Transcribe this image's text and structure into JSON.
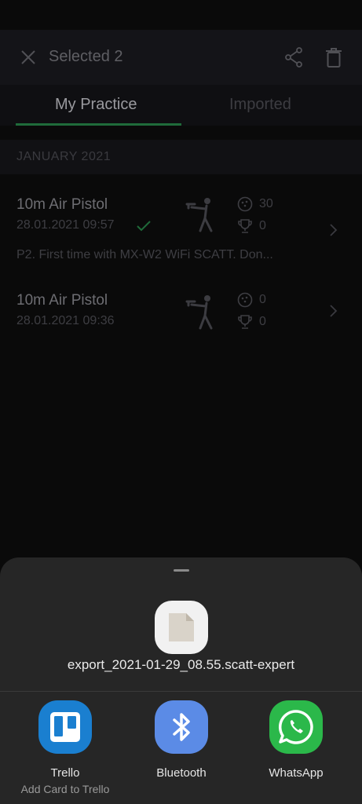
{
  "appbar": {
    "title": "Selected 2",
    "close_icon": "close-icon",
    "share_icon": "share-icon",
    "delete_icon": "trash-icon"
  },
  "tabs": [
    {
      "label": "My Practice",
      "active": true
    },
    {
      "label": "Imported",
      "active": false
    }
  ],
  "section": {
    "header": "JANUARY 2021"
  },
  "sessions": [
    {
      "name": "10m Air Pistol",
      "datetime": "28.01.2021 09:57",
      "synced": true,
      "shots": "30",
      "trophies": "0",
      "note": "P2. First time with MX-W2 WiFi SCATT. Don..."
    },
    {
      "name": "10m Air Pistol",
      "datetime": "28.01.2021 09:36",
      "synced": false,
      "shots": "0",
      "trophies": "0",
      "note": ""
    }
  ],
  "share_sheet": {
    "filename": "export_2021-01-29_08.55.scatt-expert",
    "apps": [
      {
        "label": "Trello",
        "sublabel": "Add Card to Trello",
        "color": "#1a7fd0",
        "icon": "trello-icon"
      },
      {
        "label": "Bluetooth",
        "sublabel": "",
        "color": "#5b8be6",
        "icon": "bluetooth-icon"
      },
      {
        "label": "WhatsApp",
        "sublabel": "",
        "color": "#2bb84a",
        "icon": "whatsapp-icon"
      }
    ]
  },
  "colors": {
    "accent": "#1f6b3a",
    "sheet_bg": "#262626"
  }
}
